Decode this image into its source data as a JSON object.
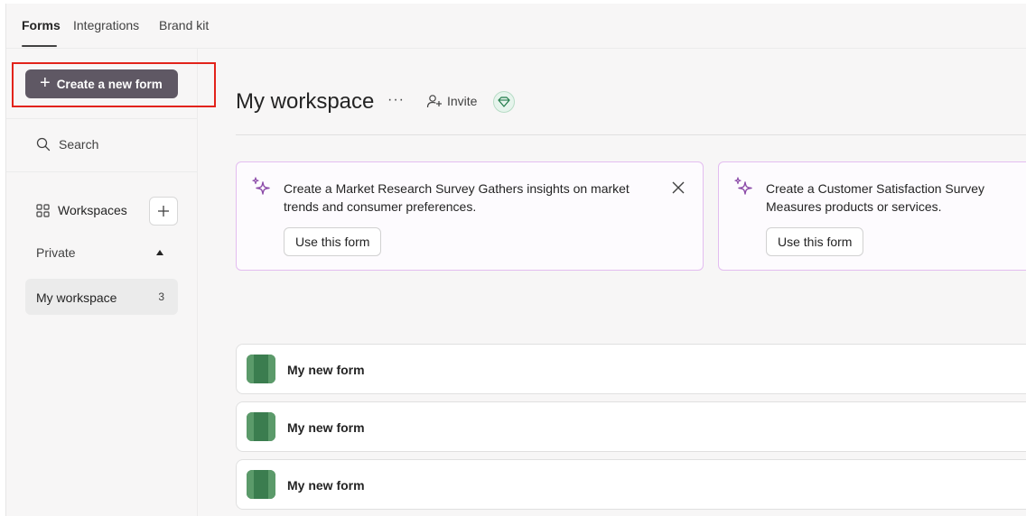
{
  "topnav": {
    "tabs": [
      {
        "label": "Forms",
        "active": true
      },
      {
        "label": "Integrations",
        "active": false
      },
      {
        "label": "Brand kit",
        "active": false
      }
    ]
  },
  "sidebar": {
    "create_label": "Create a new form",
    "search_label": "Search",
    "workspaces_label": "Workspaces",
    "private_label": "Private",
    "workspace_item": {
      "label": "My workspace",
      "count": "3"
    }
  },
  "main": {
    "title": "My workspace",
    "more_label": "···",
    "invite_label": "Invite",
    "suggestions": [
      {
        "text": "Create a Market Research Survey Gathers insights on market trends and consumer preferences.",
        "button": "Use this form"
      },
      {
        "text": "Create a Customer Satisfaction Survey Measures products or services.",
        "button": "Use this form"
      }
    ],
    "forms": [
      {
        "name": "My new form"
      },
      {
        "name": "My new form"
      },
      {
        "name": "My new form"
      }
    ]
  },
  "colors": {
    "create_button_bg": "#5f5864",
    "highlight_border": "#e2231a",
    "card_border": "#e3bdf0",
    "form_icon": "#3b7d4f"
  },
  "icons": [
    "plus-icon",
    "search-icon",
    "grid-icon",
    "caret-up-icon",
    "more-icon",
    "person-add-icon",
    "diamond-icon",
    "sparkle-icon",
    "close-icon",
    "form-icon"
  ]
}
